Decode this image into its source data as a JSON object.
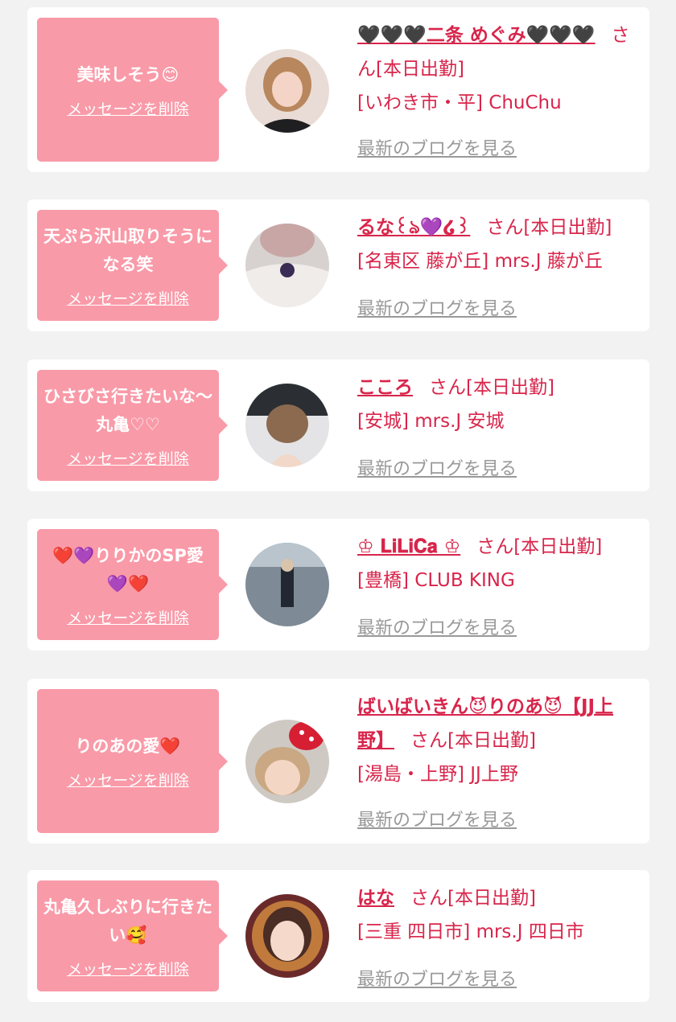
{
  "delete_label": "メッセージを削除",
  "blog_label": "最新のブログを見る",
  "san_suffix": "さん",
  "items": [
    {
      "message": "美味しそう😊",
      "name": "🖤🖤🖤二条 めぐみ🖤🖤🖤",
      "status": "[本日出勤]",
      "shop": "[いわき市・平] ChuChu"
    },
    {
      "message": "天ぷら沢山取りそうになる笑",
      "name": "るな꒰ঌ💜໒꒱",
      "status": "[本日出勤]",
      "shop": "[名東区 藤が丘] mrs.J 藤が丘"
    },
    {
      "message": "ひさびさ行きたいな〜丸亀♡♡",
      "name": "こころ",
      "status": "[本日出勤]",
      "shop": "[安城] mrs.J 安城"
    },
    {
      "message": "❤️💜りりかのSP愛💜❤️",
      "name": "♔ 𝐋𝐢𝐋𝐢𝐂𝐚 ♔",
      "status": "[本日出勤]",
      "shop": "[豊橋] CLUB KING"
    },
    {
      "message": "りのあの愛❤️",
      "name": "ばいばいきん😈りのあ😈【JJ上野】",
      "status": "[本日出勤]",
      "shop": "[湯島・上野] JJ上野"
    },
    {
      "message": "丸亀久しぶりに行きたい🥰",
      "name": "はな",
      "status": "[本日出勤]",
      "shop": "[三重 四日市] mrs.J 四日市"
    }
  ]
}
